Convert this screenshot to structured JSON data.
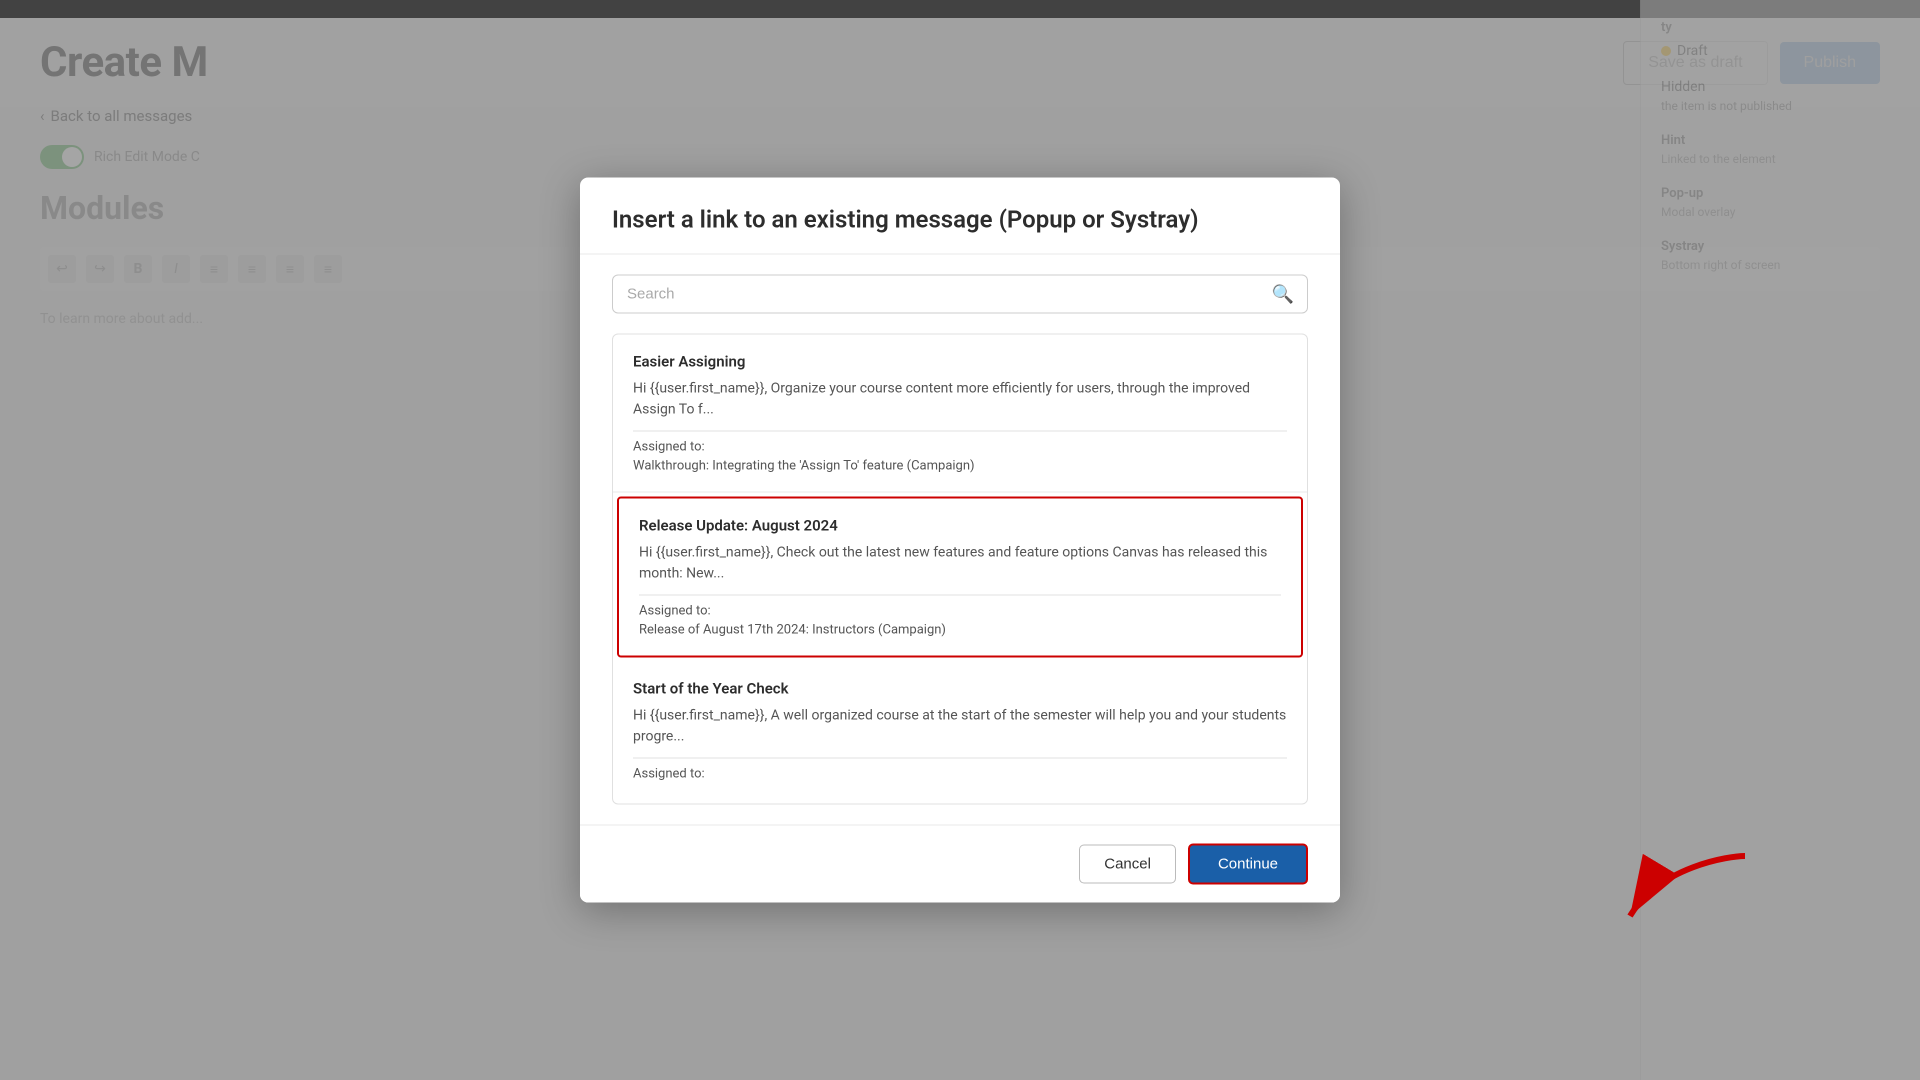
{
  "page": {
    "title": "Create M",
    "topbar_height": 18
  },
  "header": {
    "title": "Create M",
    "save_draft_label": "Save as draft",
    "publish_label": "Publish",
    "back_link_label": "Back to all messages"
  },
  "content": {
    "toggle_label": "Rich Edit Mode C",
    "modules_title": "Modules",
    "editor_placeholder": "To learn more about add..."
  },
  "right_panel": {
    "visibility_label": "ty",
    "draft_label": "Draft",
    "hidden_label": "Hidden",
    "hidden_desc": "the item is not published",
    "hint_label": "Hint",
    "hint_desc": "Linked to the element",
    "popup_label": "Pop-up",
    "popup_desc": "Modal overlay",
    "systray_label": "Systray",
    "systray_desc": "Bottom right of screen"
  },
  "modal": {
    "title": "Insert a link to an existing message (Popup or Systray)",
    "search_placeholder": "Search",
    "messages": [
      {
        "id": "easier-assigning",
        "title": "Easier Assigning",
        "preview": "Hi {{user.first_name}}, Organize your course content more efficiently for users, through the improved Assign To f...",
        "assigned_label": "Assigned to:",
        "assigned_value": "Walkthrough: Integrating the 'Assign To' feature (Campaign)",
        "selected": false
      },
      {
        "id": "release-update",
        "title": "Release Update: August 2024",
        "preview": "Hi {{user.first_name}}, Check out the latest new features and feature options Canvas has released this month: New...",
        "assigned_label": "Assigned to:",
        "assigned_value": "Release of August 17th 2024: Instructors (Campaign)",
        "selected": true
      },
      {
        "id": "start-of-year",
        "title": "Start of the Year Check",
        "preview": "Hi {{user.first_name}}, A well organized course at the start of the semester will help you and your students progre...",
        "assigned_label": "Assigned to:",
        "assigned_value": "",
        "selected": false
      }
    ],
    "cancel_label": "Cancel",
    "continue_label": "Continue"
  }
}
